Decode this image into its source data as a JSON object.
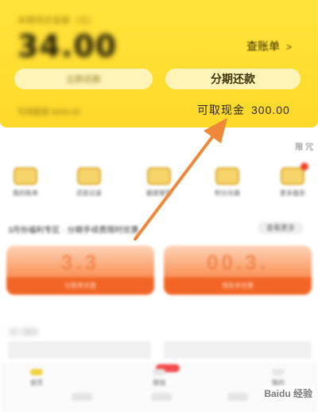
{
  "account": {
    "header_caption": "本期待还金额（元）",
    "amount": "34.00",
    "bill_link": {
      "label": "查账单",
      "chevron": ">"
    },
    "repay_button": {
      "label": "立即还款"
    },
    "installment_button": {
      "label": "分期还款"
    },
    "limit_note": "可用额度 8000.00",
    "cash_withdraw": {
      "label": "可取现金",
      "value": "300.00"
    }
  },
  "notice": {
    "tag": "限 冗"
  },
  "shortcuts": [
    {
      "icon": "bill-icon",
      "label": "我的账单"
    },
    {
      "icon": "card-icon",
      "label": "还款记录"
    },
    {
      "icon": "wallet-icon",
      "label": "额度管理"
    },
    {
      "icon": "gift-icon",
      "label": "积分兑换"
    },
    {
      "icon": "more-icon",
      "label": "更多服务"
    }
  ],
  "promo": {
    "title": "3月份福利专区 · 分期手续费限时优惠",
    "more_label": "查看更多",
    "coupons": [
      {
        "headline": "3.3",
        "caption": "分期享优惠"
      },
      {
        "headline": "00.3.",
        "caption": "借款享优惠"
      }
    ]
  },
  "lower": {
    "title": "热门推荐"
  },
  "nav": {
    "items": [
      {
        "label": "首页"
      },
      {
        "label": "借钱"
      },
      {
        "label": "我的"
      }
    ]
  },
  "watermark": "Baidu 经验",
  "colors": {
    "card_yellow": "#ffdf34",
    "installment_button": "#fff4b8",
    "coupon_orange": "#f26526",
    "arrow": "#f0883a"
  }
}
